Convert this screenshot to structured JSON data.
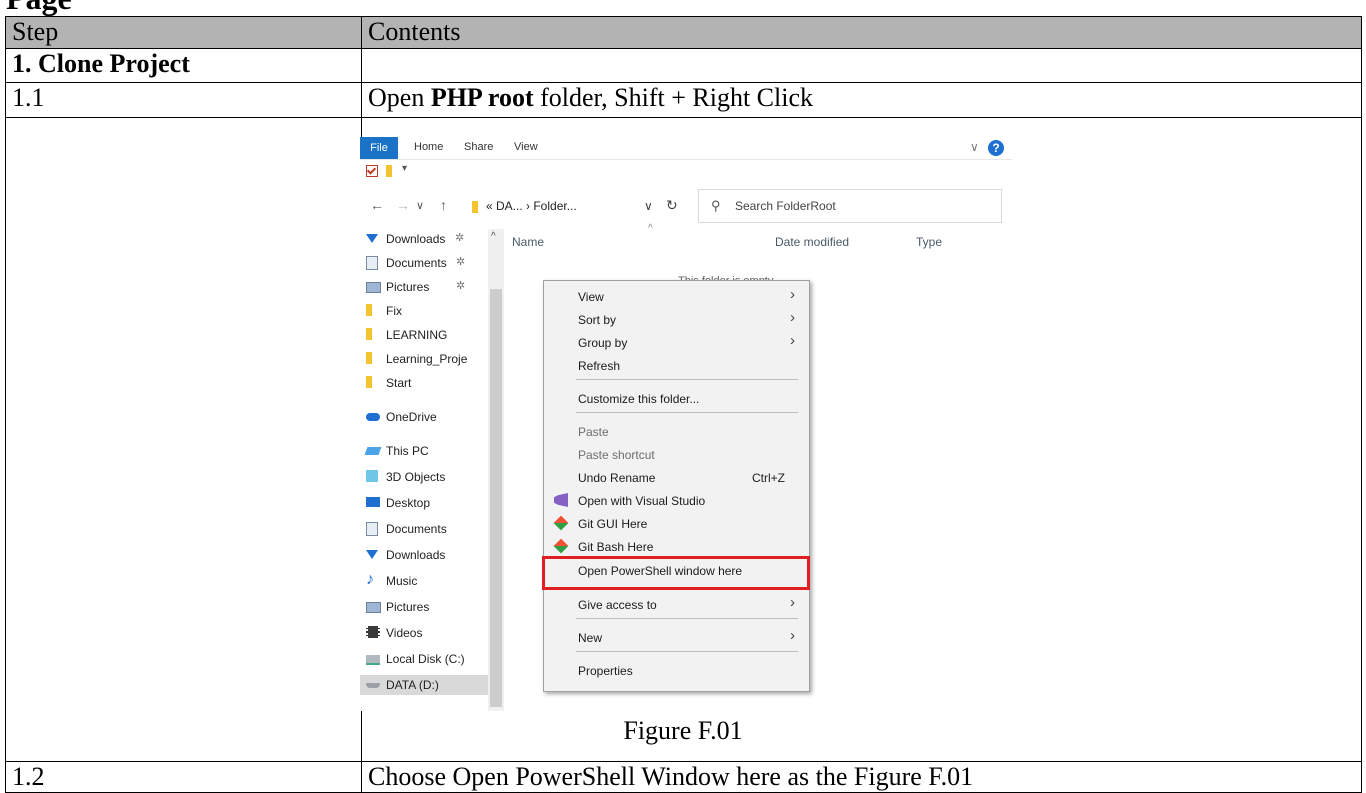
{
  "table": {
    "header": {
      "step": "Step",
      "contents": "Contents"
    },
    "section": {
      "title": "1. Clone Project"
    },
    "row_1_1": {
      "step": "1.1",
      "text_prefix": "Open ",
      "text_bold": "PHP root",
      "text_suffix": " folder, Shift + Right Click"
    },
    "figure_caption": "Figure F.01",
    "row_1_2": {
      "step": "1.2",
      "text": "Choose Open PowerShell Window here as the Figure F.01"
    }
  },
  "explorer": {
    "ribbon_tabs": [
      "File",
      "Home",
      "Share",
      "View"
    ],
    "address": {
      "path": "« DA... › Folder..."
    },
    "search": {
      "placeholder": "Search FolderRoot"
    },
    "sidebar_items": [
      {
        "label": "Downloads",
        "icon": "download-icon",
        "pinned": true
      },
      {
        "label": "Documents",
        "icon": "document-icon",
        "pinned": true
      },
      {
        "label": "Pictures",
        "icon": "pictures-icon",
        "pinned": true
      },
      {
        "label": "Fix",
        "icon": "folder-icon"
      },
      {
        "label": "LEARNING",
        "icon": "folder-icon"
      },
      {
        "label": "Learning_Proje",
        "icon": "folder-icon"
      },
      {
        "label": "Start",
        "icon": "folder-icon"
      },
      {
        "label": "OneDrive",
        "icon": "cloud-icon"
      },
      {
        "label": "This PC",
        "icon": "pc-icon"
      },
      {
        "label": "3D Objects",
        "icon": "3d-objects-icon"
      },
      {
        "label": "Desktop",
        "icon": "desktop-icon"
      },
      {
        "label": "Documents",
        "icon": "document-icon"
      },
      {
        "label": "Downloads",
        "icon": "download-icon"
      },
      {
        "label": "Music",
        "icon": "music-icon"
      },
      {
        "label": "Pictures",
        "icon": "pictures-icon"
      },
      {
        "label": "Videos",
        "icon": "videos-icon"
      },
      {
        "label": "Local Disk (C:)",
        "icon": "local-disk-icon"
      },
      {
        "label": "DATA (D:)",
        "icon": "drive-icon"
      }
    ],
    "columns": [
      "Name",
      "Date modified",
      "Type"
    ],
    "empty_text": "This folder is empty.",
    "context_menu": [
      {
        "label": "View",
        "submenu": true
      },
      {
        "label": "Sort by",
        "submenu": true
      },
      {
        "label": "Group by",
        "submenu": true
      },
      {
        "label": "Refresh"
      },
      {
        "label": "Customize this folder..."
      },
      {
        "label": "Paste",
        "disabled": true
      },
      {
        "label": "Paste shortcut",
        "disabled": true
      },
      {
        "label": "Undo Rename",
        "shortcut": "Ctrl+Z"
      },
      {
        "label": "Open with Visual Studio",
        "icon": "visual-studio-icon"
      },
      {
        "label": "Git GUI Here",
        "icon": "git-icon"
      },
      {
        "label": "Git Bash Here",
        "icon": "git-icon"
      },
      {
        "label": "Open PowerShell window here",
        "highlighted": true
      },
      {
        "label": "Give access to",
        "submenu": true
      },
      {
        "label": "New",
        "submenu": true
      },
      {
        "label": "Properties"
      }
    ],
    "colors": {
      "file_tab": "#1a73c6",
      "highlight_box": "#e02020",
      "menu_bg": "#f2f2f2"
    }
  }
}
